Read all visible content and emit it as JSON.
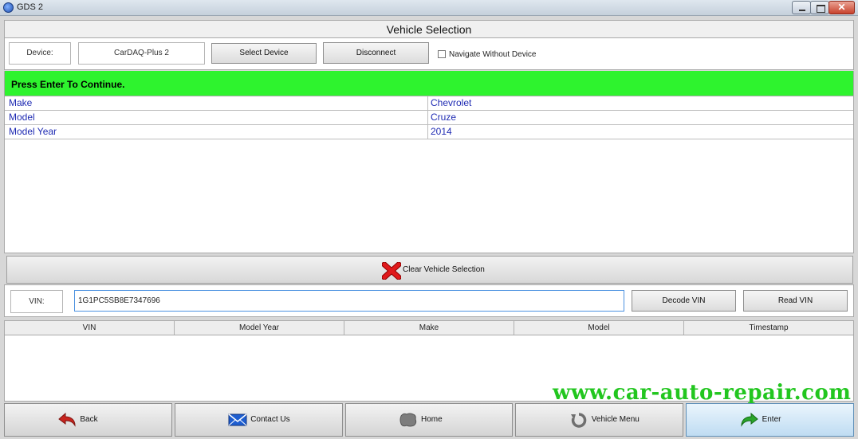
{
  "window": {
    "title": "GDS 2"
  },
  "header": {
    "title": "Vehicle Selection"
  },
  "device": {
    "label": "Device:",
    "value": "CarDAQ-Plus 2",
    "select_button": "Select Device",
    "disconnect_button": "Disconnect",
    "navigate_checkbox_label": "Navigate Without Device",
    "navigate_checked": false
  },
  "status": {
    "message": "Press Enter To Continue.",
    "color": "#2ef32e"
  },
  "vehicle": {
    "rows": [
      {
        "label": "Make",
        "value": "Chevrolet"
      },
      {
        "label": "Model",
        "value": "Cruze"
      },
      {
        "label": "Model Year",
        "value": "2014"
      }
    ]
  },
  "clear": {
    "label": "Clear Vehicle Selection",
    "icon": "red-x-icon"
  },
  "vin": {
    "label": "VIN:",
    "value": "1G1PC5SB8E7347696",
    "decode_button": "Decode VIN",
    "read_button": "Read VIN"
  },
  "history": {
    "columns": [
      "VIN",
      "Model Year",
      "Make",
      "Model",
      "Timestamp"
    ]
  },
  "watermark": {
    "text": "www.car-auto-repair.com"
  },
  "nav": [
    {
      "label": "Back",
      "icon": "back-arrow-icon"
    },
    {
      "label": "Contact Us",
      "icon": "envelope-icon"
    },
    {
      "label": "Home",
      "icon": "home-icon"
    },
    {
      "label": "Vehicle Menu",
      "icon": "refresh-icon"
    },
    {
      "label": "Enter",
      "icon": "forward-arrow-icon"
    }
  ]
}
